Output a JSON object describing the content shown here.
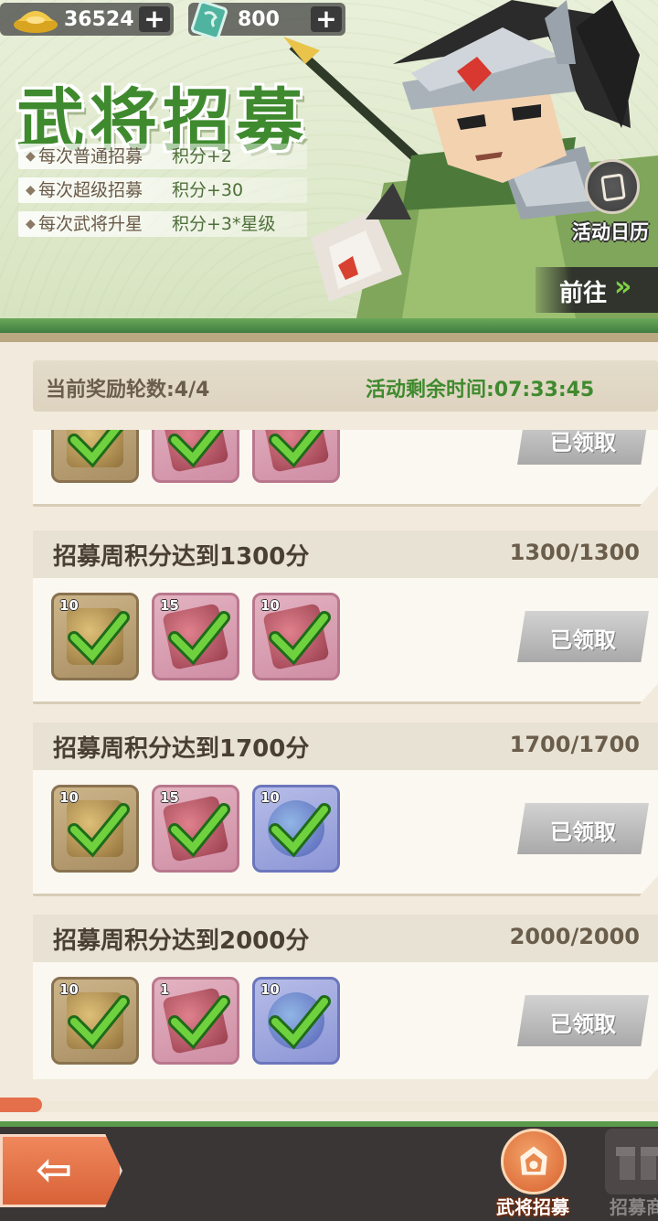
{
  "currency": {
    "gold": {
      "icon": "gold-ingot-icon",
      "value": "36524",
      "plus": "+"
    },
    "ticket": {
      "icon": "recruit-ticket-icon",
      "value": "800",
      "plus": "+"
    }
  },
  "banner": {
    "title": "武将招募",
    "rules": [
      {
        "text": "每次普通招募",
        "points": "积分+2"
      },
      {
        "text": "每次超级招募",
        "points": "积分+30"
      },
      {
        "text": "每次武将升星",
        "points": "积分+3*星级"
      }
    ],
    "calendar_label": "活动日历",
    "goto_label": "前往",
    "goto_arrows": "»"
  },
  "info": {
    "rounds": "当前奖励轮数:4/4",
    "timer": "活动剩余时间:07:33:45"
  },
  "rewards": [
    {
      "name": "",
      "progress": "",
      "items": [
        {
          "kind": "gold",
          "qty": ""
        },
        {
          "kind": "red",
          "qty": ""
        },
        {
          "kind": "red",
          "qty": ""
        }
      ],
      "button": "已领取"
    },
    {
      "name": "招募周积分达到1300分",
      "progress": "1300/1300",
      "items": [
        {
          "kind": "gold",
          "qty": "10"
        },
        {
          "kind": "red",
          "qty": "15"
        },
        {
          "kind": "red",
          "qty": "10"
        }
      ],
      "button": "已领取"
    },
    {
      "name": "招募周积分达到1700分",
      "progress": "1700/1700",
      "items": [
        {
          "kind": "gold",
          "qty": "10"
        },
        {
          "kind": "red",
          "qty": "15"
        },
        {
          "kind": "blue",
          "qty": "10"
        }
      ],
      "button": "已领取"
    },
    {
      "name": "招募周积分达到2000分",
      "progress": "2000/2000",
      "items": [
        {
          "kind": "gold",
          "qty": "10"
        },
        {
          "kind": "red",
          "qty": "1"
        },
        {
          "kind": "blue",
          "qty": "10"
        }
      ],
      "button": "已领取"
    }
  ],
  "bottom": {
    "back_icon": "back-arrow-icon",
    "back_arrow": "⇦",
    "tabs": [
      {
        "label": "武将招募",
        "icon": "recruit-icon",
        "active": true
      },
      {
        "label": "招募商",
        "icon": "gift-shop-icon",
        "active": false
      }
    ]
  },
  "colors": {
    "accent_green": "#3f8a2e",
    "claimed_gray": "#a9a9a9",
    "back_orange": "#d86238"
  }
}
